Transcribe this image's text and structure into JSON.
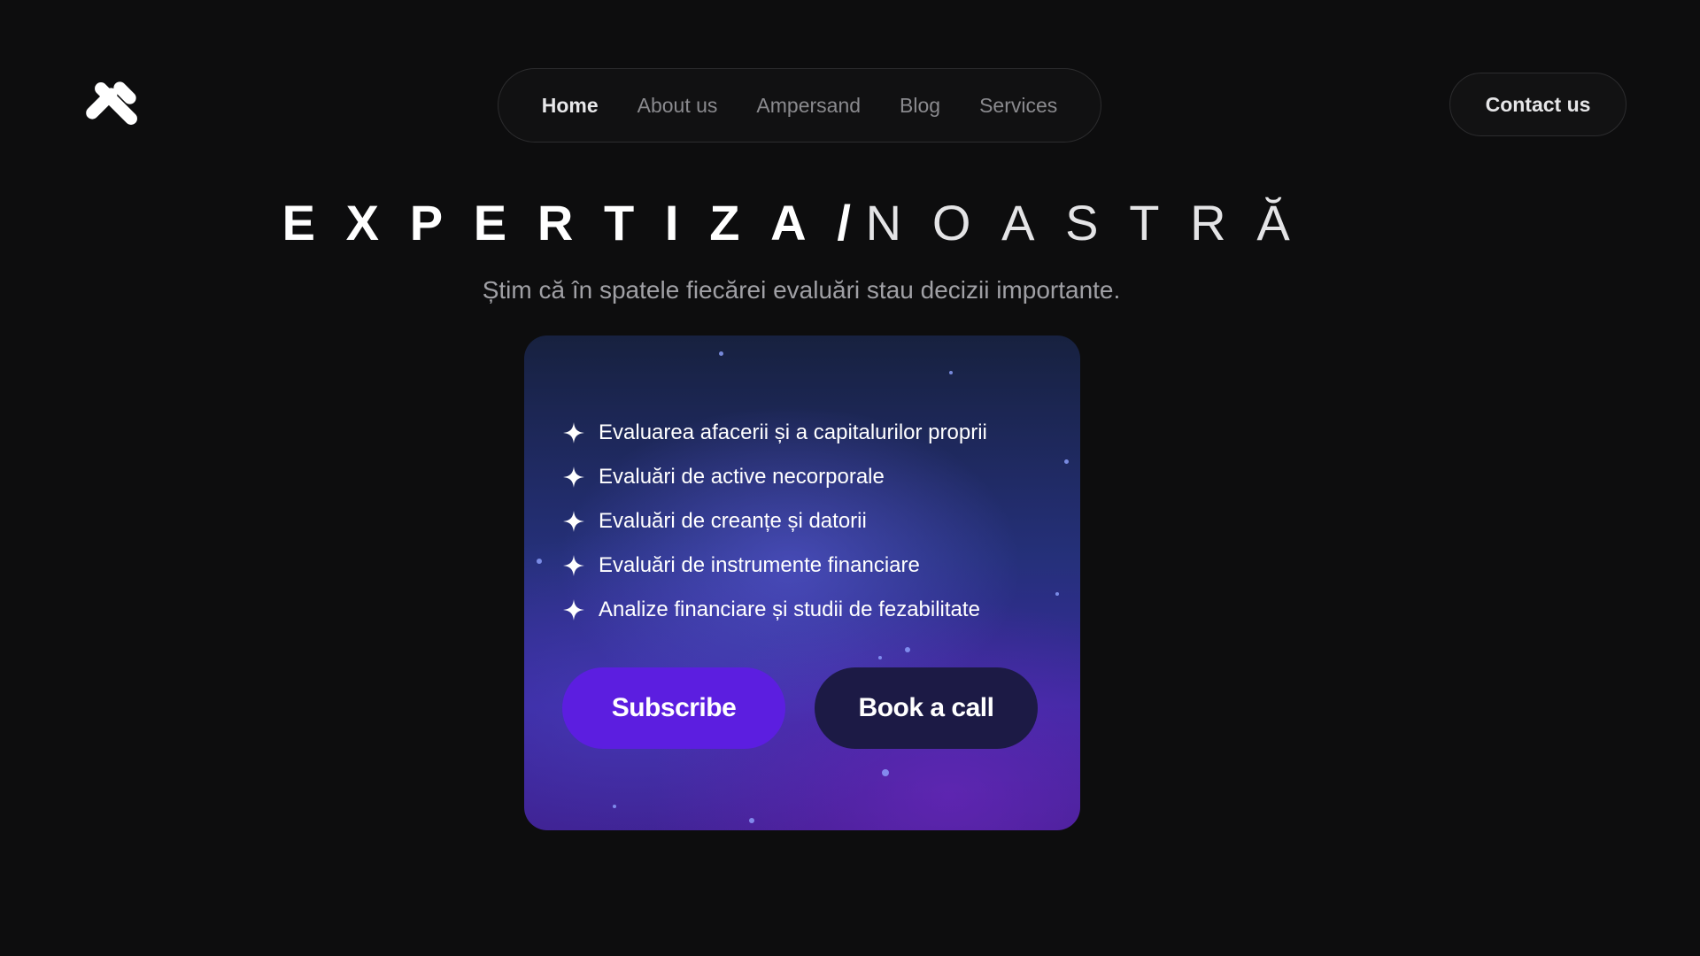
{
  "nav": {
    "items": [
      {
        "label": "Home",
        "active": true
      },
      {
        "label": "About us",
        "active": false
      },
      {
        "label": "Ampersand",
        "active": false
      },
      {
        "label": "Blog",
        "active": false
      },
      {
        "label": "Services",
        "active": false
      }
    ]
  },
  "header": {
    "contact_label": "Contact us",
    "logo_icon": "brand-logo-icon"
  },
  "hero": {
    "title_bold": "EXPERTIZA",
    "title_slash": "/",
    "title_light": "NOASTRĂ",
    "subtitle": "Știm că în spatele fiecărei evaluări stau decizii importante."
  },
  "card": {
    "bullet_icon": "sparkle-icon",
    "items": [
      "Evaluarea afacerii și a capitalurilor proprii",
      "Evaluări de active necorporale",
      "Evaluări de creanțe și datorii",
      "Evaluări de instrumente financiare",
      "Analize financiare și studii de fezabilitate"
    ],
    "subscribe_label": "Subscribe",
    "book_label": "Book a call"
  },
  "colors": {
    "background": "#0d0d0e",
    "subscribe": "#5c1ee0",
    "book": "#1c1a45"
  }
}
